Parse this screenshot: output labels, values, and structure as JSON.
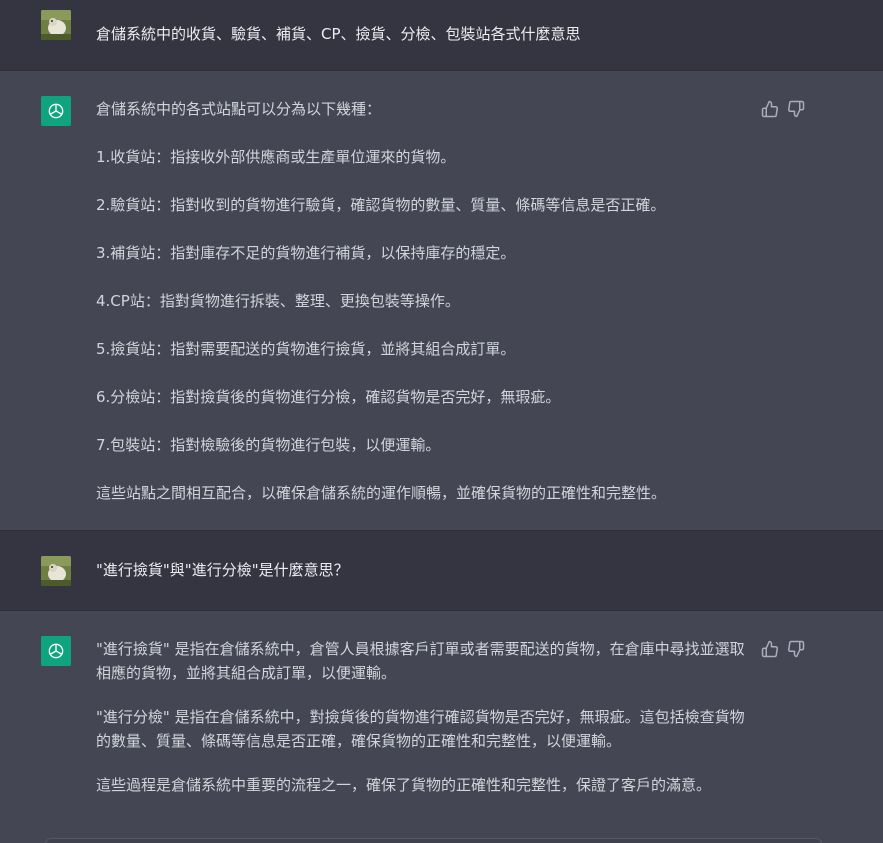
{
  "messages": [
    {
      "role": "user",
      "text": "倉儲系統中的收貨、驗貨、補貨、CP、撿貨、分檢、包裝站各式什麼意思"
    },
    {
      "role": "assistant",
      "paragraphs": [
        "倉儲系統中的各式站點可以分為以下幾種：",
        "1.收貨站：指接收外部供應商或生產單位運來的貨物。",
        "2.驗貨站：指對收到的貨物進行驗貨，確認貨物的數量、質量、條碼等信息是否正確。",
        "3.補貨站：指對庫存不足的貨物進行補貨，以保持庫存的穩定。",
        "4.CP站：指對貨物進行拆裝、整理、更換包裝等操作。",
        "5.撿貨站：指對需要配送的貨物進行撿貨，並將其組合成訂單。",
        "6.分檢站：指對撿貨後的貨物進行分檢，確認貨物是否完好，無瑕疵。",
        "7.包裝站：指對檢驗後的貨物進行包裝，以便運輸。",
        "這些站點之間相互配合，以確保倉儲系統的運作順暢，並確保貨物的正確性和完整性。"
      ]
    },
    {
      "role": "user",
      "text": "\"進行撿貨\"與\"進行分檢\"是什麼意思？"
    },
    {
      "role": "assistant",
      "paragraphs": [
        "\"進行撿貨\" 是指在倉儲系統中，倉管人員根據客戶訂單或者需要配送的貨物，在倉庫中尋找並選取相應的貨物，並將其組合成訂單，以便運輸。",
        "\"進行分檢\" 是指在倉儲系統中，對撿貨後的貨物進行確認貨物是否完好，無瑕疵。這包括檢查貨物的數量、質量、條碼等信息是否正確，確保貨物的正確性和完整性，以便運輸。",
        "這些過程是倉儲系統中重要的流程之一，確保了貨物的正確性和完整性，保證了客戶的滿意。"
      ]
    }
  ],
  "icons": {
    "bot_avatar": "openai-logo-icon",
    "thumbs_up": "thumbs-up-icon",
    "thumbs_down": "thumbs-down-icon"
  },
  "colors": {
    "user_bg": "#343541",
    "assistant_bg": "#444654",
    "bot_avatar_bg": "#10a37f"
  }
}
